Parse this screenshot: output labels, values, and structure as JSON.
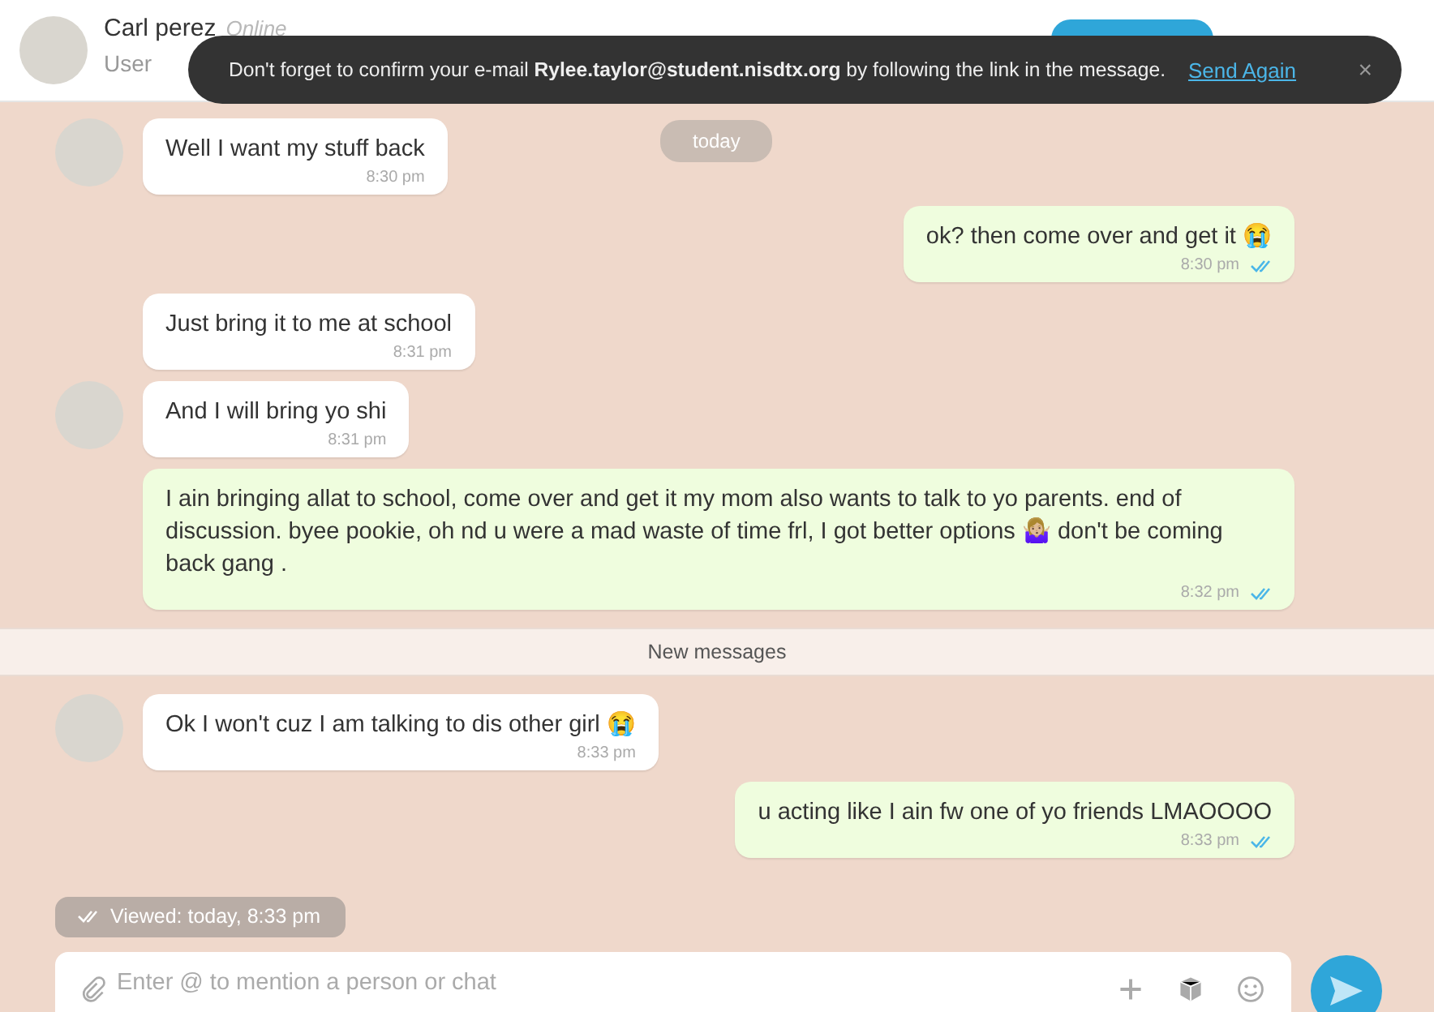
{
  "header": {
    "name": "Carl perez",
    "status": "Online",
    "role": "User"
  },
  "toast": {
    "text": "Don't forget to confirm your e-mail **Rylee.taylor@student.nisdtx.org** by following the link in the message.",
    "action": "Send Again",
    "close": "×"
  },
  "date_badge": "today",
  "messages": [
    {
      "kind": "in",
      "avatar": true,
      "parts": [
        {
          "kind": "text",
          "text": "Well I want my stuff back"
        }
      ],
      "time": "8:30 pm"
    },
    {
      "kind": "out",
      "read": true,
      "parts": [
        {
          "kind": "text",
          "text": "ok? then come over and get it 😭"
        }
      ],
      "time": "8:30 pm"
    },
    {
      "kind": "in",
      "avatar": false,
      "parts": [
        {
          "kind": "text",
          "text": "Just bring it to me at school"
        }
      ],
      "time": "8:31 pm"
    },
    {
      "kind": "in",
      "avatar": true,
      "parts": [
        {
          "kind": "text",
          "text": "And I will bring yo shi"
        }
      ],
      "time": "8:31 pm"
    },
    {
      "kind": "out",
      "read": true,
      "parts": [
        {
          "kind": "text",
          "text": "I ain bringing allat to school, come over and get it my mom also wants to talk to yo parents. end of discussion. byee pookie, oh nd u were a mad waste of time frl, I got better options 🤷🏼‍♀️ don't be coming back gang ."
        }
      ],
      "time": "8:32 pm"
    },
    {
      "kind": "divider",
      "text": "New messages"
    },
    {
      "kind": "in",
      "avatar": true,
      "parts": [
        {
          "kind": "text",
          "text": "Ok I won't cuz I am talking to dis other girl 😭"
        }
      ],
      "time": "8:33 pm"
    },
    {
      "kind": "out",
      "read": true,
      "parts": [
        {
          "kind": "text",
          "text": "u acting like I ain fw one of yo friends LMAOOOO"
        }
      ],
      "time": "8:33 pm"
    }
  ],
  "viewed": "Viewed: today, 8:33 pm",
  "composer": {
    "placeholder": "Enter @ to mention a person or chat"
  }
}
